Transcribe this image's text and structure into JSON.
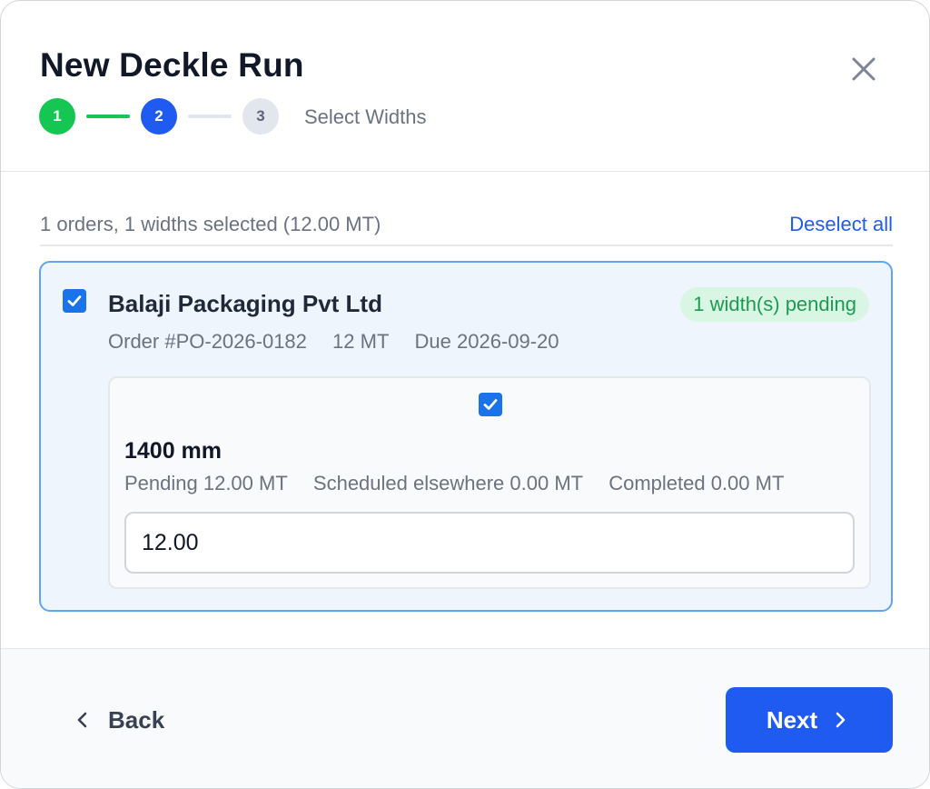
{
  "dialog": {
    "title": "New Deckle Run",
    "close_icon": "close-icon"
  },
  "stepper": {
    "steps": [
      {
        "number": "1",
        "state": "completed",
        "color": "#16c653"
      },
      {
        "number": "2",
        "state": "current",
        "color": "#1f5bf0"
      },
      {
        "number": "3",
        "state": "upcoming",
        "color": "#e2e6ed"
      }
    ],
    "current_label": "Select Widths"
  },
  "selection": {
    "summary": "1 orders, 1 widths selected (12.00 MT)",
    "deselect_label": "Deselect all"
  },
  "orders": [
    {
      "checked": true,
      "customer": "Balaji Packaging Pvt Ltd",
      "badge": "1 width(s) pending",
      "order_no": "Order #PO-2026-0182",
      "quantity": "12 MT",
      "due": "Due 2026-09-20",
      "widths": [
        {
          "checked": true,
          "width": "1400 mm",
          "pending": "Pending 12.00 MT",
          "scheduled": "Scheduled elsewhere 0.00 MT",
          "completed": "Completed 0.00 MT",
          "input_value": "12.00"
        }
      ]
    }
  ],
  "footer": {
    "back_label": "Back",
    "next_label": "Next"
  },
  "colors": {
    "accent": "#1f5bf0",
    "success": "#16c653",
    "checkbox": "#1a73e8"
  }
}
